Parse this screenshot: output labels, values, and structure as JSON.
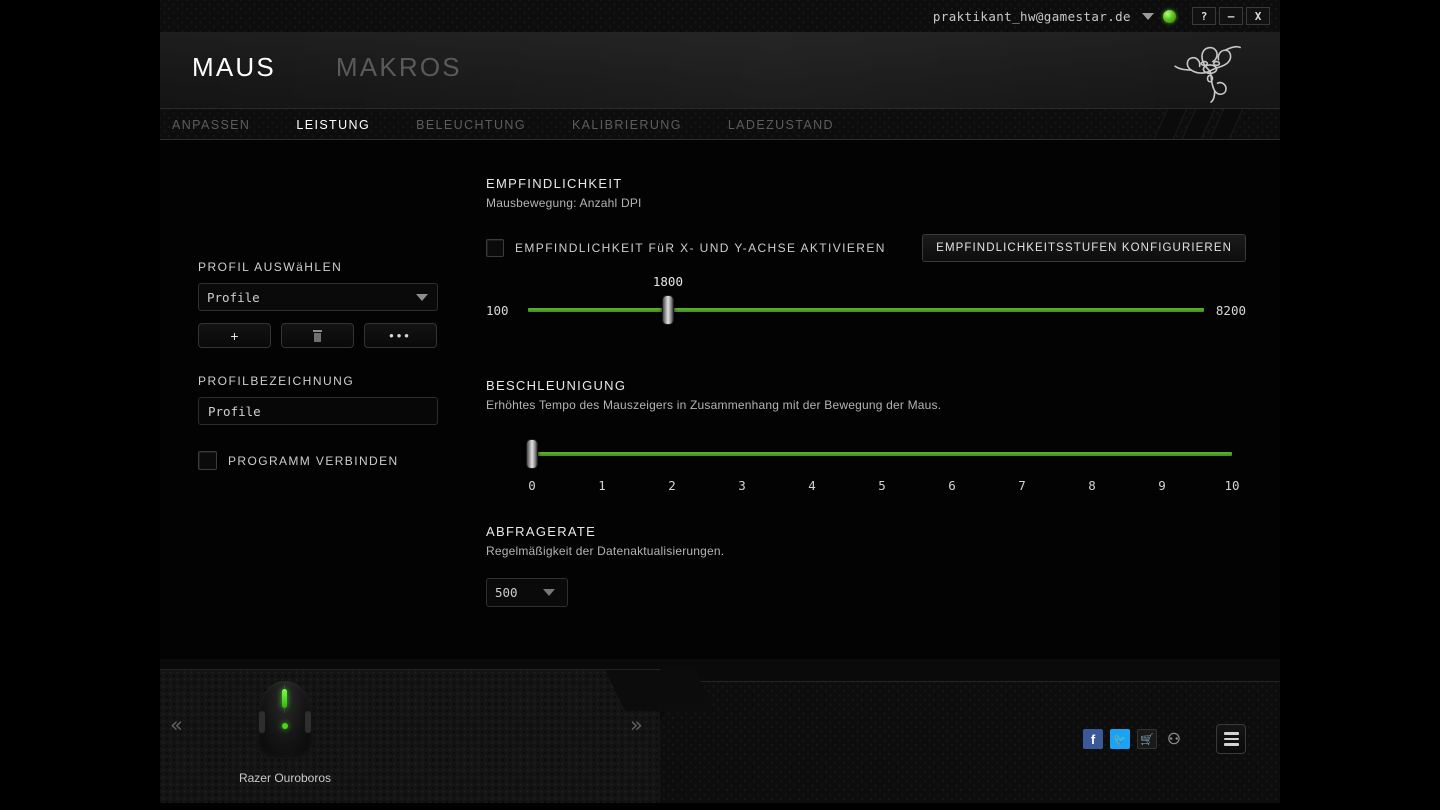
{
  "titlebar": {
    "account": "praktikant_hw@gamestar.de",
    "dropdown_icon": "chevron-down-icon",
    "status_icon": "online-status-dot",
    "status_color": "#5fc321",
    "help_label": "?",
    "minimize_label": "–",
    "close_label": "X"
  },
  "header": {
    "main_tabs": [
      {
        "label": "MAUS",
        "active": true
      },
      {
        "label": "MAKROS",
        "active": false
      }
    ],
    "logo_icon": "razer-logo-icon"
  },
  "subtabs": [
    {
      "label": "ANPASSEN",
      "active": false
    },
    {
      "label": "LEISTUNG",
      "active": true
    },
    {
      "label": "BELEUCHTUNG",
      "active": false
    },
    {
      "label": "KALIBRIERUNG",
      "active": false
    },
    {
      "label": "LADEZUSTAND",
      "active": false
    }
  ],
  "sidebar": {
    "profile_select_label": "PROFIL AUSWäHLEN",
    "profile_select_value": "Profile",
    "profile_select_caret": "chevron-down-icon",
    "add_button": "+",
    "delete_button_icon": "trash-icon",
    "more_button": "•••",
    "profile_name_label": "PROFILBEZEICHNUNG",
    "profile_name_value": "Profile",
    "profile_name_placeholder": "Profile",
    "link_program_label": "PROGRAMM VERBINDEN",
    "link_program_checked": false
  },
  "main": {
    "sensitivity": {
      "title": "EMPFINDLICHKEIT",
      "subtitle": "Mausbewegung: Anzahl DPI",
      "xy_checkbox_label": "EMPFINDLICHKEIT FüR X- UND Y-ACHSE AKTIVIEREN",
      "xy_checkbox_checked": false,
      "configure_button": "EMPFINDLICHKEITSSTUFEN KONFIGURIEREN"
    },
    "acceleration": {
      "title": "BESCHLEUNIGUNG",
      "subtitle": "Erhöhtes Tempo des Mauszeigers in Zusammenhang mit der Bewegung der Maus."
    },
    "polling": {
      "title": "ABFRAGERATE",
      "subtitle": "Regelmäßigkeit der Datenaktualisierungen.",
      "value": "500",
      "caret": "chevron-down-icon"
    }
  },
  "chart_data": [
    {
      "type": "slider",
      "name": "dpi-slider",
      "title": "EMPFINDLICHKEIT",
      "min_label": "100",
      "max_label": "8200",
      "min": 100,
      "max": 8200,
      "value": 1800,
      "value_label": "1800",
      "handle_percent": 20.7,
      "track_color": "#4f9f26",
      "grid": false
    },
    {
      "type": "slider",
      "name": "acceleration-slider",
      "title": "BESCHLEUNIGUNG",
      "min": 0,
      "max": 10,
      "value": 0,
      "tick_labels": [
        "0",
        "1",
        "2",
        "3",
        "4",
        "5",
        "6",
        "7",
        "8",
        "9",
        "10"
      ],
      "handle_percent": 0,
      "track_color": "#4f9f26",
      "grid": false
    }
  ],
  "footer": {
    "prev_arrow": "«",
    "next_arrow": "»",
    "device_name": "Razer Ouroboros",
    "device_icon": "mouse-icon",
    "socials": [
      {
        "name": "facebook-icon",
        "glyph": "f",
        "color": "#3b5998"
      },
      {
        "name": "twitter-icon",
        "glyph": "🐦",
        "color": "#1da1f2"
      },
      {
        "name": "cart-icon",
        "glyph": "🛒",
        "color": "#1a1a1a"
      },
      {
        "name": "razer-logo-icon",
        "glyph": "⚇",
        "color": "transparent"
      }
    ],
    "menu_icon": "hamburger-menu-icon"
  }
}
